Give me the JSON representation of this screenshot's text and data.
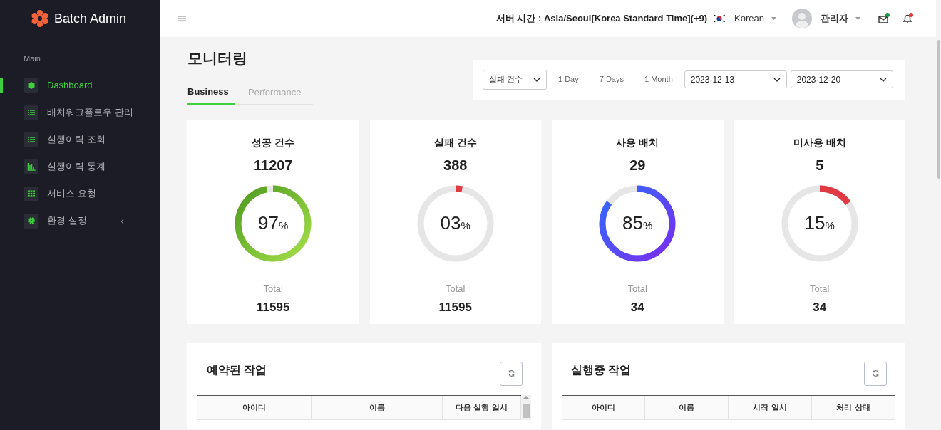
{
  "sidebar": {
    "brand": "Batch Admin",
    "section": "Main",
    "items": [
      {
        "label": "Dashboard",
        "kind": "cube",
        "selected": true
      },
      {
        "label": "배치워크플로우 관리",
        "kind": "list",
        "selected": false
      },
      {
        "label": "실행이력 조회",
        "kind": "list",
        "selected": false
      },
      {
        "label": "실행이력 통계",
        "kind": "chart",
        "selected": false
      },
      {
        "label": "서비스 요청",
        "kind": "grid",
        "selected": false
      },
      {
        "label": "환경 설정",
        "kind": "gear",
        "selected": false,
        "caret": "‹"
      }
    ]
  },
  "header": {
    "server_time": "서버 시간 : Asia/Seoul[Korea Standard Time](+9)",
    "language": "Korean",
    "user": "관리자"
  },
  "page": {
    "title": "모니터링",
    "tabs": [
      {
        "label": "Business",
        "selected": true
      },
      {
        "label": "Performance",
        "selected": false
      }
    ],
    "filter": {
      "type": "실패 건수",
      "ranges": [
        "1 Day",
        "7 Days",
        "1 Month"
      ],
      "start": "2023-12-13",
      "end": "2023-12-20"
    },
    "cards": [
      {
        "title": "성공 건수",
        "count": "11207",
        "percent": "97",
        "unit": "%",
        "level": 0.97,
        "kind": "success",
        "total_label": "Total",
        "total": "11595"
      },
      {
        "title": "실패 건수",
        "count": "388",
        "percent": "03",
        "unit": "%",
        "level": 0.03,
        "kind": "fail",
        "total_label": "Total",
        "total": "11595"
      },
      {
        "title": "사용 배치",
        "count": "29",
        "percent": "85",
        "unit": "%",
        "level": 0.85,
        "kind": "used",
        "total_label": "Total",
        "total": "34"
      },
      {
        "title": "미사용 배치",
        "count": "5",
        "percent": "15",
        "unit": "%",
        "level": 0.15,
        "kind": "fail",
        "total_label": "Total",
        "total": "34"
      }
    ],
    "panels": [
      {
        "title": "예약된 작업",
        "columns": [
          "아이디",
          "이름",
          "다음 실행 일시"
        ]
      },
      {
        "title": "실행중 작업",
        "columns": [
          "아이디",
          "이름",
          "시작 일시",
          "처리 상태"
        ]
      }
    ]
  }
}
